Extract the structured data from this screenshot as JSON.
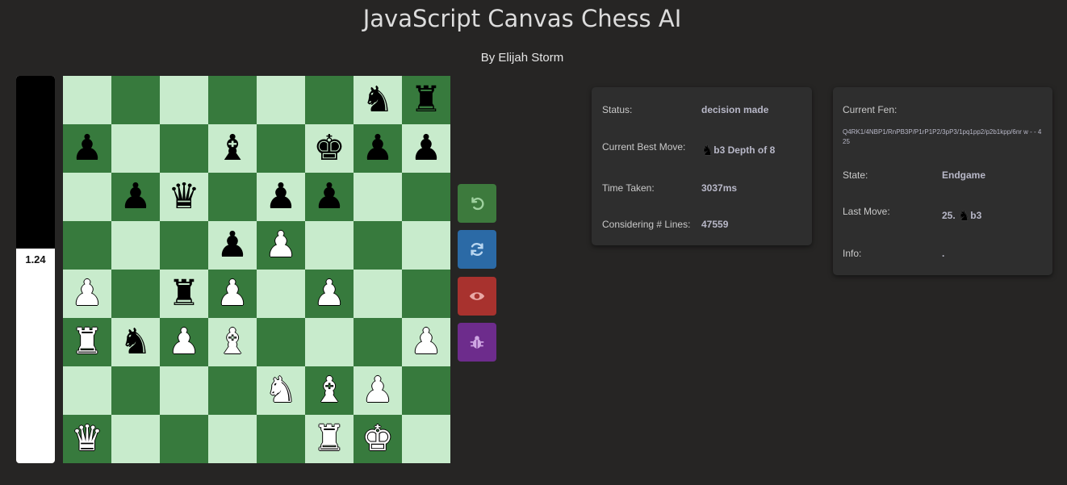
{
  "header": {
    "title": "JavaScript Canvas Chess AI",
    "subtitle": "By Elijah Storm"
  },
  "eval_bar": {
    "score": "1.24",
    "black_fraction": 0.446,
    "colors": {
      "black": "#000000",
      "white": "#ffffff"
    }
  },
  "board": {
    "light_color": "#c8ebcc",
    "dark_color": "#377a3d",
    "ranks": [
      [
        "",
        "",
        "",
        "",
        "",
        "",
        "bN",
        "bR"
      ],
      [
        "bP",
        "",
        "",
        "bB",
        "",
        "bK",
        "bP",
        "bP"
      ],
      [
        "",
        "bP",
        "bQ",
        "",
        "bP",
        "bP",
        "",
        ""
      ],
      [
        "",
        "",
        "",
        "bP",
        "wP",
        "",
        "",
        ""
      ],
      [
        "wP",
        "",
        "bR",
        "wP",
        "",
        "wP",
        "",
        ""
      ],
      [
        "wR",
        "bN",
        "wP",
        "wB",
        "",
        "",
        "",
        "wP"
      ],
      [
        "",
        "",
        "",
        "",
        "wN",
        "wB",
        "wP",
        ""
      ],
      [
        "wQ",
        "",
        "",
        "",
        "",
        "wR",
        "wK",
        ""
      ]
    ]
  },
  "controls": [
    {
      "name": "undo-button",
      "icon": "undo-icon",
      "color": "#3d7a3d"
    },
    {
      "name": "flip-board-button",
      "icon": "refresh-icon",
      "color": "#2b6aa6"
    },
    {
      "name": "show-button",
      "icon": "eye-icon",
      "color": "#a8322e"
    },
    {
      "name": "debug-button",
      "icon": "bug-icon",
      "color": "#6d2c8c"
    }
  ],
  "status_panel": {
    "status_label": "Status:",
    "status_value": "decision made",
    "best_move_label": "Current Best Move:",
    "best_move_piece": "knight-icon",
    "best_move_value": "b3 Depth of 8",
    "time_label": "Time Taken:",
    "time_value": "3037ms",
    "lines_label": "Considering # Lines:",
    "lines_value": "47559"
  },
  "info_panel": {
    "fen_label": "Current Fen:",
    "fen_value": "Q4RK1/4NBP1/RnPB3P/P1rP1P2/3pP3/1pq1pp2/p2b1kpp/6nr w - - 4 25",
    "state_label": "State:",
    "state_value": "Endgame",
    "last_move_label": "Last Move:",
    "last_move_number": "25.",
    "last_move_piece": "knight-icon",
    "last_move_value": "b3",
    "info_label": "Info:",
    "info_value": "."
  }
}
